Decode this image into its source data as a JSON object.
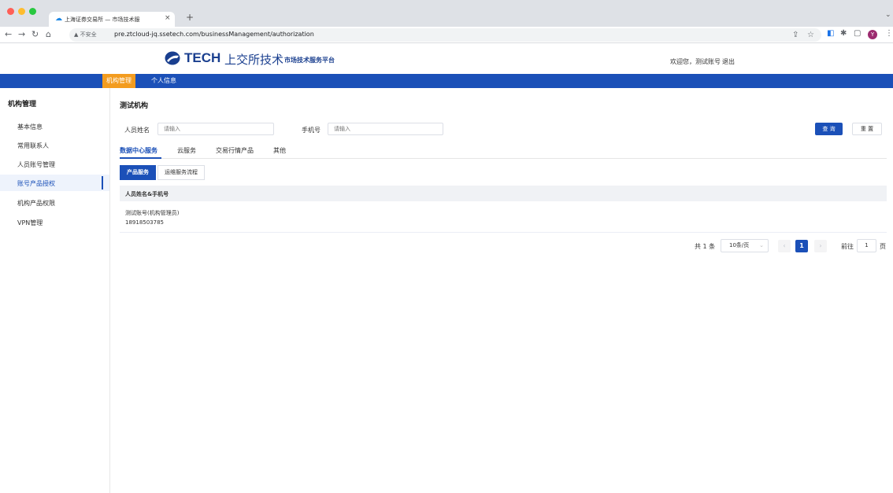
{
  "browser": {
    "tab_title": "上海证券交易所 — 市场技术服",
    "tab_close": "×",
    "new_tab": "+",
    "insecure_label": "▲ 不安全",
    "url": "pre.ztcloud-jq.ssetech.com/businessManagement/authorization",
    "profile_initial": "Y"
  },
  "header": {
    "logo_text": "TECH",
    "logo_cn": "上交所技术",
    "platform": "市场技术服务平台",
    "welcome": "欢迎您，测试账号",
    "logout": "退出"
  },
  "nav": {
    "items": [
      "机构管理",
      "个人信息"
    ]
  },
  "sidebar": {
    "title": "机构管理",
    "items": [
      "基本信息",
      "常用联系人",
      "人员账号管理",
      "账号产品授权",
      "机构产品权限",
      "VPN管理"
    ]
  },
  "main": {
    "title": "测试机构",
    "filters": {
      "name_label": "人员姓名",
      "name_placeholder": "请输入",
      "phone_label": "手机号",
      "phone_placeholder": "请输入"
    },
    "query_button": "查 询",
    "reset_button": "重 置",
    "tabs": [
      "数据中心服务",
      "云服务",
      "交易行情产品",
      "其他"
    ],
    "segments": [
      "产品服务",
      "运维服务流程"
    ],
    "table": {
      "header": "人员姓名&手机号",
      "rows": [
        {
          "name": "测试账号(机构管理员)",
          "phone": "18918503785"
        }
      ]
    },
    "pagination": {
      "total": "共 1 条",
      "page_size": "10条/页",
      "current_page": "1",
      "goto_label": "前往",
      "goto_value": "1",
      "goto_unit": "页"
    }
  }
}
